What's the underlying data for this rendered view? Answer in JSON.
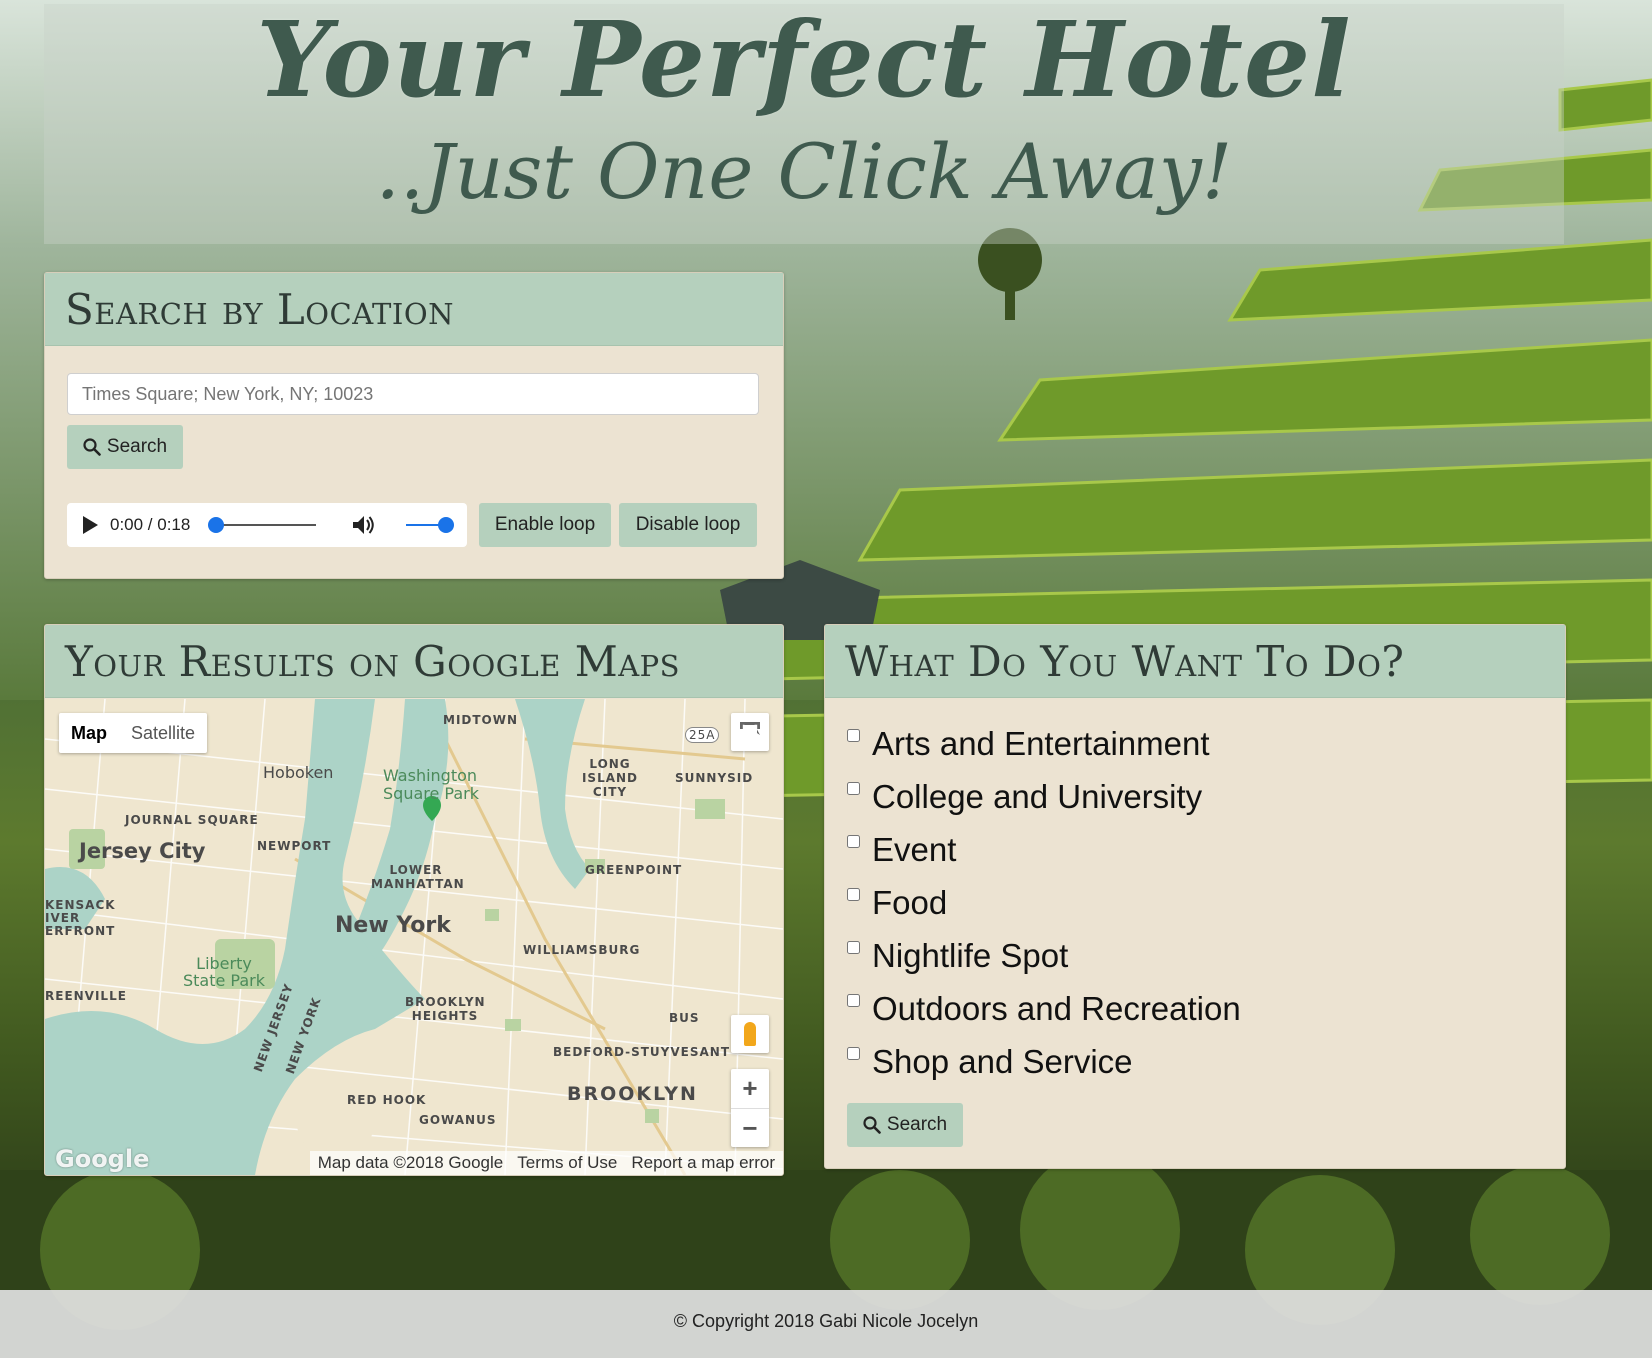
{
  "hero": {
    "title": "Your Perfect Hotel",
    "subtitle": "..Just One Click Away!"
  },
  "search_card": {
    "heading": "Search by Location",
    "input_placeholder": "Times Square; New York, NY; 10023",
    "search_label": "Search",
    "audio": {
      "time": "0:00 / 0:18",
      "progress": 0,
      "volume": 1.0
    },
    "enable_loop_label": "Enable loop",
    "disable_loop_label": "Disable loop"
  },
  "map_card": {
    "heading": "Your Results on Google Maps",
    "map_type": [
      "Map",
      "Satellite"
    ],
    "labels": {
      "midtown": "MIDTOWN",
      "hoboken": "Hoboken",
      "washington": "Washington Square Park",
      "long_island": "LONG ISLAND CITY",
      "sunnyside": "SUNNYSID",
      "journal_square": "JOURNAL SQUARE",
      "jersey_city": "Jersey City",
      "newport": "NEWPORT",
      "lower_manhattan": "LOWER MANHATTAN",
      "greenpoint": "GREENPOINT",
      "hackensack": "KENSACK IVER ERFRONT",
      "new_york": "New York",
      "williamsburg": "WILLIAMSBURG",
      "liberty": "Liberty State Park",
      "greenville": "REENVILLE",
      "brooklyn_heights": "BROOKLYN HEIGHTS",
      "new_jersey": "NEW JERSEY",
      "new_york_state": "NEW YORK",
      "bedford": "BEDFORD-STUYVESANT",
      "red_hook": "RED HOOK",
      "gowanus": "GOWANUS",
      "brooklyn": "BROOKLYN",
      "bus": "BUS",
      "route": "25A"
    },
    "zoom_in": "+",
    "zoom_out": "−",
    "google_logo": "Google",
    "attribution": [
      "Map data ©2018 Google",
      "Terms of Use",
      "Report a map error"
    ]
  },
  "todo_card": {
    "heading": "What Do You Want To Do?",
    "options": [
      "Arts and Entertainment",
      "College and University",
      "Event",
      "Food",
      "Nightlife Spot",
      "Outdoors and Recreation",
      "Shop and Service"
    ],
    "search_label": "Search"
  },
  "footer": {
    "text": "© Copyright 2018 Gabi Nicole Jocelyn"
  },
  "colors": {
    "card_bg": "#ece3d2",
    "card_header": "#b5d0bd",
    "button": "#b5d0bd",
    "title_text": "#3f5a4e",
    "accent_blue": "#1a73e8"
  },
  "icons": {
    "search": "search-icon",
    "play": "play-icon",
    "volume": "volume-icon",
    "fullscreen": "fullscreen-icon",
    "pegman": "pegman-icon",
    "map_pin": "map-pin-icon"
  }
}
